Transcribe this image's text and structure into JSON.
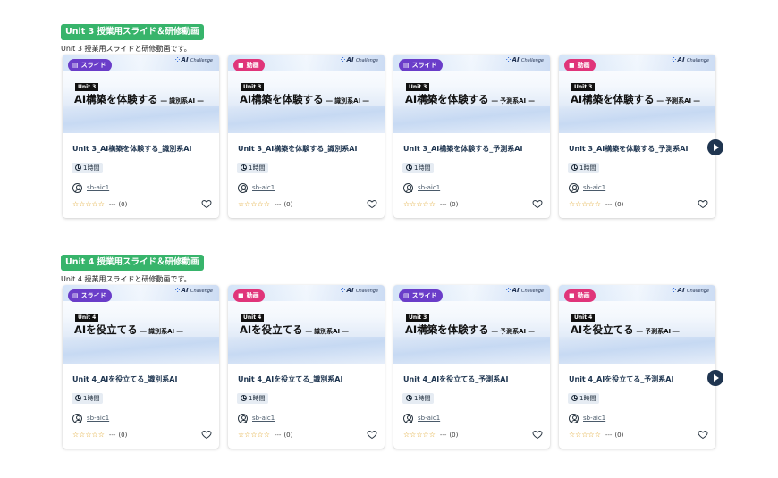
{
  "colors": {
    "section_badge": "#37b46b",
    "slide_badge": "#6a3dc9",
    "video_badge": "#e0357a",
    "star": "#e0a72e",
    "title": "#1e3550"
  },
  "brand": {
    "name": "AI",
    "sub": "Challenge"
  },
  "sections": [
    {
      "badge": "Unit 3 授業用スライド＆研修動画",
      "description": "Unit 3 授業用スライドと研修動画です。",
      "cards": [
        {
          "type_label": "スライド",
          "type": "slide",
          "unit_tag": "Unit 3",
          "thumb_title": "AI構築を体験する",
          "thumb_sub": "― 識別系AI ―",
          "title": "Unit 3_AI構築を体験する_識別系AI",
          "duration": "1時間",
          "author": "sb-aic1",
          "stars": "☆☆☆☆☆",
          "rating_dots": "---",
          "rating_count": "(0)"
        },
        {
          "type_label": "動画",
          "type": "video",
          "unit_tag": "Unit 3",
          "thumb_title": "AI構築を体験する",
          "thumb_sub": "― 識別系AI ―",
          "title": "Unit 3_AI構築を体験する_識別系AI",
          "duration": "1時間",
          "author": "sb-aic1",
          "stars": "☆☆☆☆☆",
          "rating_dots": "---",
          "rating_count": "(0)"
        },
        {
          "type_label": "スライド",
          "type": "slide",
          "unit_tag": "Unit 3",
          "thumb_title": "AI構築を体験する",
          "thumb_sub": "― 予測系AI ―",
          "title": "Unit 3_AI構築を体験する_予測系AI",
          "duration": "1時間",
          "author": "sb-aic1",
          "stars": "☆☆☆☆☆",
          "rating_dots": "---",
          "rating_count": "(0)"
        },
        {
          "type_label": "動画",
          "type": "video",
          "unit_tag": "Unit 3",
          "thumb_title": "AI構築を体験する",
          "thumb_sub": "― 予測系AI ―",
          "title": "Unit 3_AI構築を体験する_予測系AI",
          "duration": "1時間",
          "author": "sb-aic1",
          "stars": "☆☆☆☆☆",
          "rating_dots": "---",
          "rating_count": "(0)"
        }
      ]
    },
    {
      "badge": "Unit 4 授業用スライド＆研修動画",
      "description": "Unit 4 授業用スライドと研修動画です。",
      "cards": [
        {
          "type_label": "スライド",
          "type": "slide",
          "unit_tag": "Unit 4",
          "thumb_title": "AIを役立てる",
          "thumb_sub": "― 識別系AI ―",
          "title": "Unit 4_AIを役立てる_識別系AI",
          "duration": "1時間",
          "author": "sb-aic1",
          "stars": "☆☆☆☆☆",
          "rating_dots": "---",
          "rating_count": "(0)"
        },
        {
          "type_label": "動画",
          "type": "video",
          "unit_tag": "Unit 4",
          "thumb_title": "AIを役立てる",
          "thumb_sub": "― 識別系AI ―",
          "title": "Unit 4_AIを役立てる_識別系AI",
          "duration": "1時間",
          "author": "sb-aic1",
          "stars": "☆☆☆☆☆",
          "rating_dots": "---",
          "rating_count": "(0)"
        },
        {
          "type_label": "スライド",
          "type": "slide",
          "unit_tag": "Unit 3",
          "thumb_title": "AI構築を体験する",
          "thumb_sub": "― 予測系AI ―",
          "title": "Unit 4_AIを役立てる_予測系AI",
          "duration": "1時間",
          "author": "sb-aic1",
          "stars": "☆☆☆☆☆",
          "rating_dots": "---",
          "rating_count": "(0)"
        },
        {
          "type_label": "動画",
          "type": "video",
          "unit_tag": "Unit 4",
          "thumb_title": "AIを役立てる",
          "thumb_sub": "― 予測系AI ―",
          "title": "Unit 4_AIを役立てる_予測系AI",
          "duration": "1時間",
          "author": "sb-aic1",
          "stars": "☆☆☆☆☆",
          "rating_dots": "---",
          "rating_count": "(0)"
        }
      ]
    }
  ]
}
